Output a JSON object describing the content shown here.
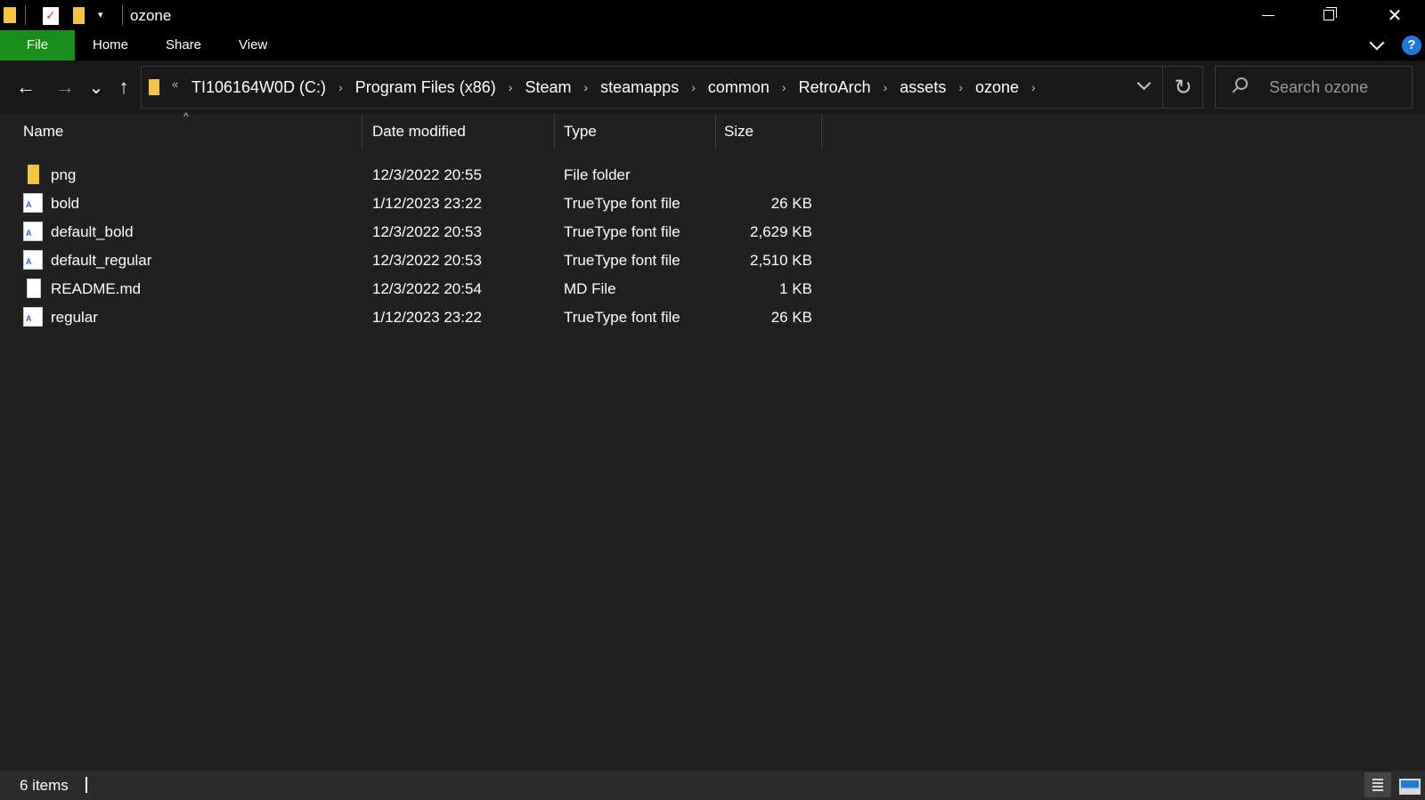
{
  "window": {
    "title": "ozone",
    "quick_access_dropdown": "▾",
    "controls": {
      "minimize": "—",
      "restore": "❐",
      "close": "✕"
    }
  },
  "ribbon": {
    "tabs": [
      {
        "label": "File",
        "active": true,
        "color": "#1a8e1a"
      },
      {
        "label": "Home"
      },
      {
        "label": "Share"
      },
      {
        "label": "View"
      }
    ],
    "help": "?"
  },
  "navigation": {
    "back": "←",
    "forward": "→",
    "recent": "⌄",
    "up": "↑",
    "overflow": "«",
    "breadcrumbs": [
      "TI106164W0D (C:)",
      "Program Files (x86)",
      "Steam",
      "steamapps",
      "common",
      "RetroArch",
      "assets",
      "ozone"
    ],
    "separator": "›",
    "refresh": "↻",
    "search_placeholder": "Search ozone"
  },
  "columns": {
    "name": "Name",
    "date": "Date modified",
    "type": "Type",
    "size": "Size"
  },
  "files": [
    {
      "name": "png",
      "date": "12/3/2022 20:55",
      "type": "File folder",
      "size": "",
      "icon": "folder-icon"
    },
    {
      "name": "bold",
      "date": "1/12/2023 23:22",
      "type": "TrueType font file",
      "size": "26 KB",
      "icon": "font-file-icon"
    },
    {
      "name": "default_bold",
      "date": "12/3/2022 20:53",
      "type": "TrueType font file",
      "size": "2,629 KB",
      "icon": "font-file-icon"
    },
    {
      "name": "default_regular",
      "date": "12/3/2022 20:53",
      "type": "TrueType font file",
      "size": "2,510 KB",
      "icon": "font-file-icon"
    },
    {
      "name": "README.md",
      "date": "12/3/2022 20:54",
      "type": "MD File",
      "size": "1 KB",
      "icon": "document-icon"
    },
    {
      "name": "regular",
      "date": "1/12/2023 23:22",
      "type": "TrueType font file",
      "size": "26 KB",
      "icon": "font-file-icon"
    }
  ],
  "status": {
    "item_count": "6 items"
  },
  "colors": {
    "background": "#202020",
    "accent": "#1a8e1a",
    "folder": "#f5c542",
    "help": "#1e7bd6"
  }
}
